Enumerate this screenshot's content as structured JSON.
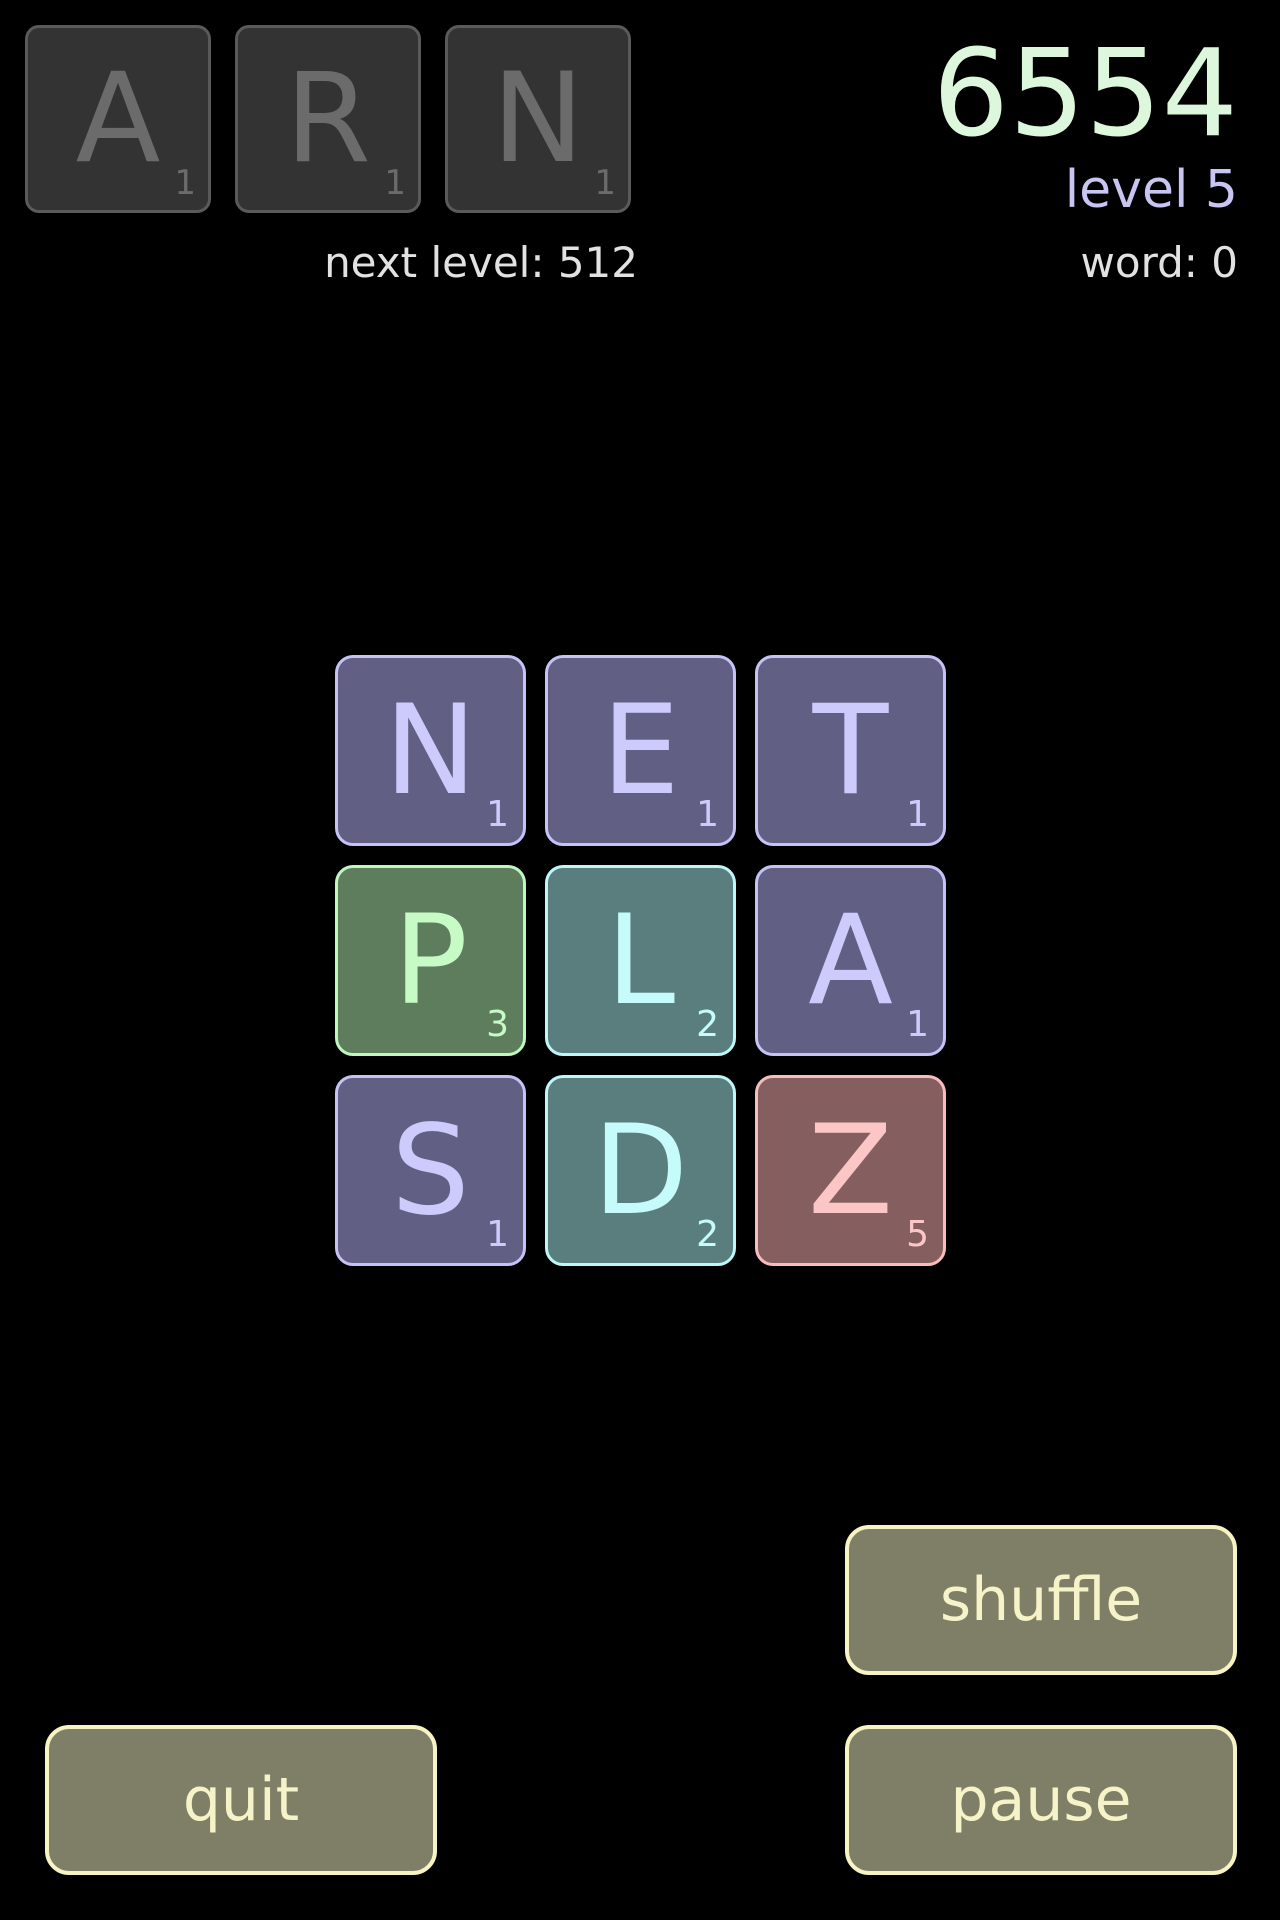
{
  "queue": [
    {
      "letter": "A",
      "points": "1"
    },
    {
      "letter": "R",
      "points": "1"
    },
    {
      "letter": "N",
      "points": "1"
    }
  ],
  "next_level_text": "next level: 512",
  "score": "6554",
  "level_text": "level 5",
  "word_text": "word: 0",
  "board": [
    [
      {
        "letter": "N",
        "points": "1",
        "color": "purple"
      },
      {
        "letter": "E",
        "points": "1",
        "color": "purple"
      },
      {
        "letter": "T",
        "points": "1",
        "color": "purple"
      }
    ],
    [
      {
        "letter": "P",
        "points": "3",
        "color": "green"
      },
      {
        "letter": "L",
        "points": "2",
        "color": "teal"
      },
      {
        "letter": "A",
        "points": "1",
        "color": "purple"
      }
    ],
    [
      {
        "letter": "S",
        "points": "1",
        "color": "purple"
      },
      {
        "letter": "D",
        "points": "2",
        "color": "teal"
      },
      {
        "letter": "Z",
        "points": "5",
        "color": "red"
      }
    ]
  ],
  "buttons": {
    "shuffle": "shuffle",
    "quit": "quit",
    "pause": "pause"
  },
  "colors": {
    "background": "#000000",
    "score": "#dcf7dc",
    "level": "#c8c5f2",
    "button_fill": "#7f7f68",
    "button_border": "#f7f3c2"
  }
}
